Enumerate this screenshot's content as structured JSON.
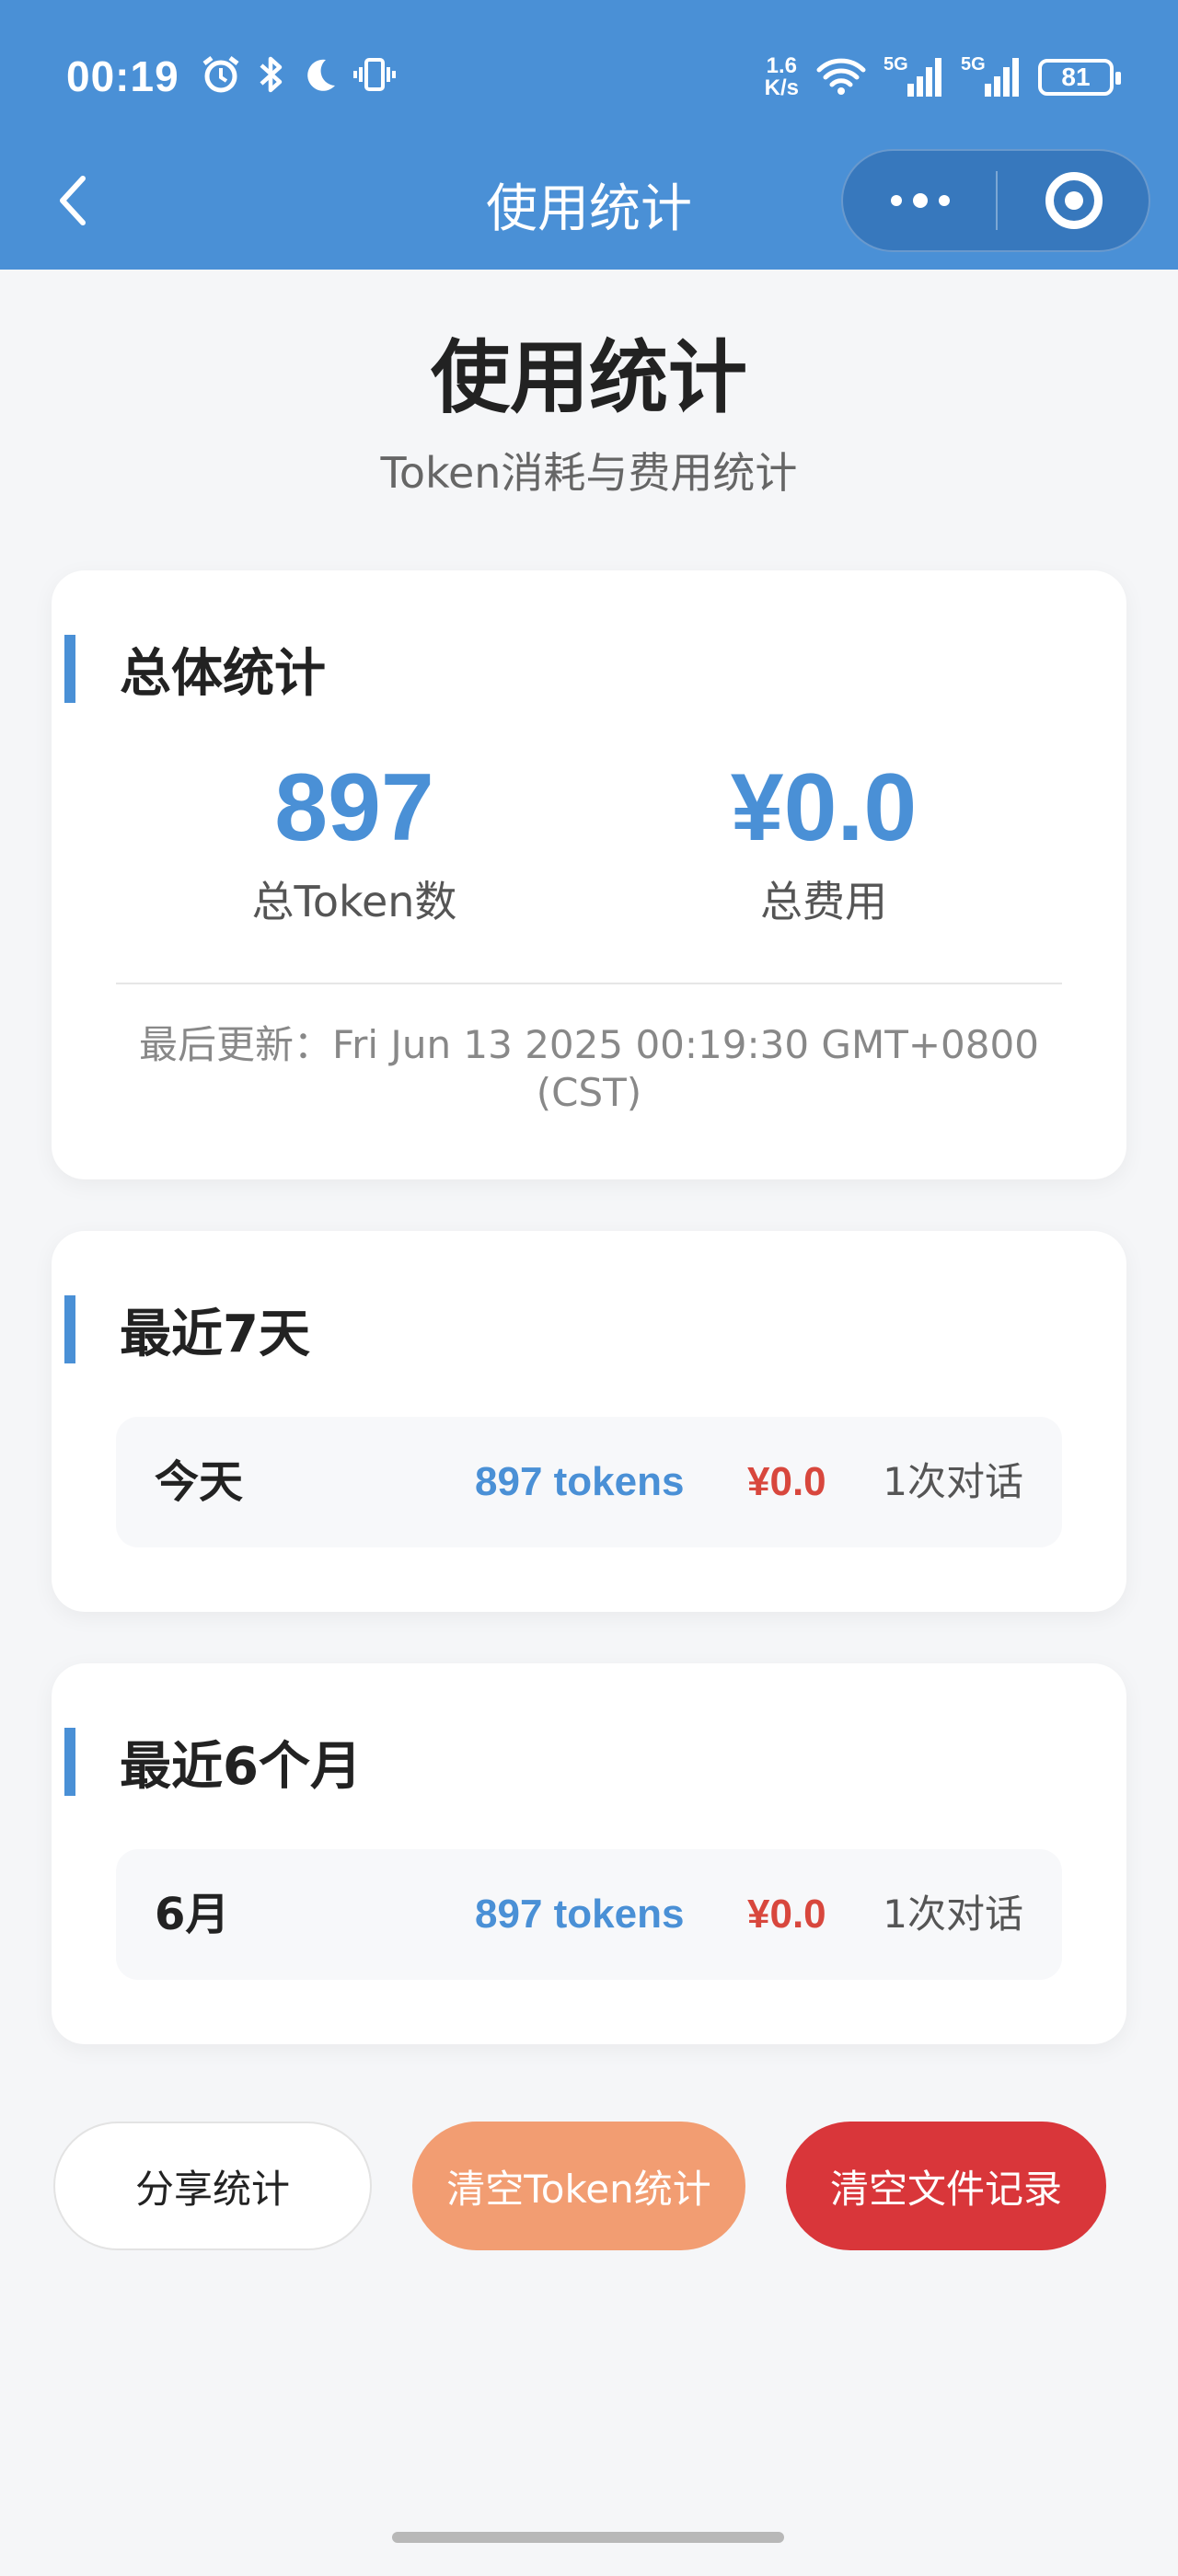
{
  "status_bar": {
    "time": "00:19",
    "net_speed_value": "1.6",
    "net_speed_unit": "K/s",
    "signal_1": "5G",
    "signal_2": "5G",
    "battery": "81",
    "icons": [
      "alarm-icon",
      "bluetooth-icon",
      "moon-icon",
      "vibrate-icon",
      "wifi-icon",
      "signal-icon",
      "signal-icon",
      "battery-icon"
    ]
  },
  "navbar": {
    "title": "使用统计",
    "back_icon": "chevron-left-icon",
    "more_icon": "more-dots-icon",
    "close_icon": "target-circle-icon"
  },
  "header": {
    "title": "使用统计",
    "subtitle": "Token消耗与费用统计"
  },
  "overall": {
    "title": "总体统计",
    "total_tokens_value": "897",
    "total_tokens_label": "总Token数",
    "total_cost_value": "¥0.0",
    "total_cost_label": "总费用",
    "last_updated": "最后更新：Fri Jun 13 2025 00:19:30 GMT+0800 (CST)"
  },
  "recent_7_days": {
    "title": "最近7天",
    "rows": [
      {
        "label": "今天",
        "tokens": "897 tokens",
        "cost": "¥0.0",
        "count": "1次对话"
      }
    ]
  },
  "recent_6_months": {
    "title": "最近6个月",
    "rows": [
      {
        "label": "6月",
        "tokens": "897 tokens",
        "cost": "¥0.0",
        "count": "1次对话"
      }
    ]
  },
  "actions": {
    "share_label": "分享统计",
    "clear_tokens_label": "清空Token统计",
    "clear_files_label": "清空文件记录"
  },
  "colors": {
    "accent": "#4a90d6",
    "cost_red": "#d8473d",
    "clear_token_btn": "#f29d72",
    "clear_files_btn": "#d9363a"
  }
}
